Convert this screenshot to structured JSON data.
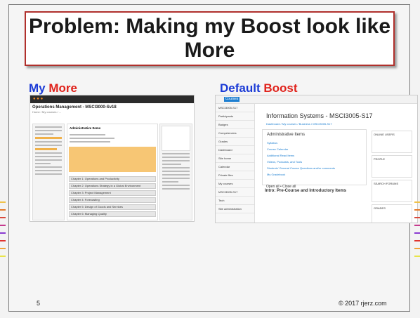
{
  "slide": {
    "title": "Problem: Making my Boost look like More",
    "left_caption": {
      "a": "My ",
      "b": "More"
    },
    "right_caption": {
      "a": "Default ",
      "b": "Boost"
    },
    "slide_number": "5",
    "copyright": "© 2017 rjerz.com",
    "colors": {
      "accent_blue": "#1b3bd6",
      "accent_red": "#e0221b",
      "border": "#b0302c"
    }
  },
  "more_screenshot": {
    "course_title": "Operations Management - MSCI3000-Sv18",
    "admin_header": "Administrative Items",
    "chapters": [
      "Chapter 1: Operations and Productivity",
      "Chapter 2: Operations Strategy in a Global Environment",
      "Chapter 3: Project Management",
      "Chapter 4: Forecasting",
      "Chapter 5: Design of Goods and Services",
      "Chapter 6: Managing Quality"
    ]
  },
  "boost_screenshot": {
    "nav_button": "Courses",
    "course_title": "Information Systems - MSCI3005-S17",
    "breadcrumb": "Dashboard / My courses / Business / MSCI3005-S17",
    "sidebar": [
      "MSCI3005-S17",
      "Participants",
      "Badges",
      "Competencies",
      "Grades",
      "Dashboard",
      "Site home",
      "Calendar",
      "Private files",
      "My courses",
      "MSCI3005-S17",
      "Tech",
      "Site administration"
    ],
    "admin_header": "Administrative Items",
    "items": [
      "Syllabus",
      "Course Calendar",
      "Additional Read Items",
      "Videos, Podcasts, and Tools",
      "Students' General Course Questions and/or comments",
      "My Gradebook",
      "Search forums"
    ],
    "open_close": "Open all   • Close all",
    "intro": "Intro: Pre-Course and Introductory Items",
    "right_blocks": [
      "ONLINE USERS",
      "PEOPLE",
      "SEARCH FORUMS",
      "GRADES"
    ]
  }
}
